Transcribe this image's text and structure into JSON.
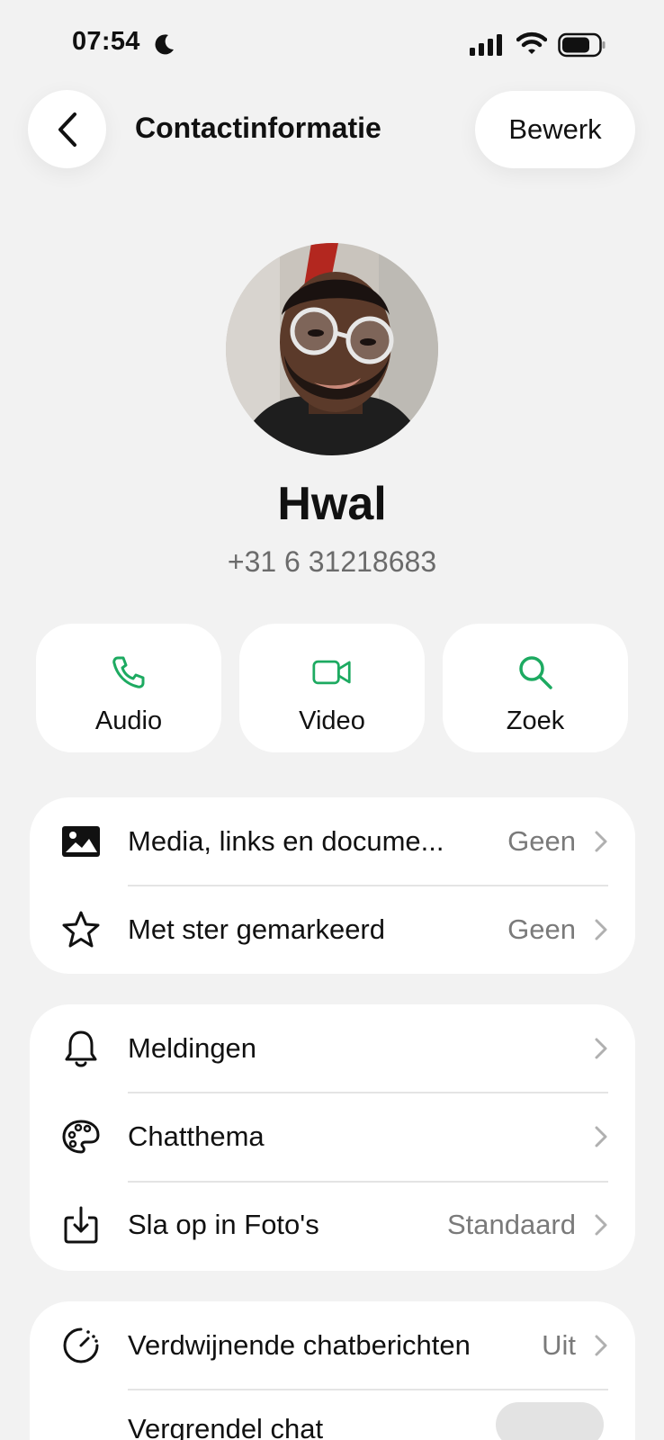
{
  "status_bar": {
    "time": "07:54"
  },
  "header": {
    "title": "Contactinformatie",
    "edit_label": "Bewerk"
  },
  "contact": {
    "name": "Hwal",
    "phone": "+31 6 31218683"
  },
  "actions": [
    {
      "label": "Audio",
      "icon": "phone-icon"
    },
    {
      "label": "Video",
      "icon": "video-icon"
    },
    {
      "label": "Zoek",
      "icon": "search-icon"
    }
  ],
  "group1": [
    {
      "label": "Media, links en docume...",
      "value": "Geen",
      "icon": "image-icon"
    },
    {
      "label": "Met ster gemarkeerd",
      "value": "Geen",
      "icon": "star-icon"
    }
  ],
  "group2": [
    {
      "label": "Meldingen",
      "value": "",
      "icon": "bell-icon"
    },
    {
      "label": "Chatthema",
      "value": "",
      "icon": "palette-icon"
    },
    {
      "label": "Sla op in Foto's",
      "value": "Standaard",
      "icon": "download-icon"
    }
  ],
  "group3": [
    {
      "label": "Verdwijnende chatberichten",
      "value": "Uit",
      "icon": "timer-icon"
    },
    {
      "label": "Vergrendel chat",
      "toggle": false,
      "icon": "lock-icon"
    }
  ],
  "colors": {
    "accent": "#1DAA61",
    "background": "#F2F2F2"
  }
}
